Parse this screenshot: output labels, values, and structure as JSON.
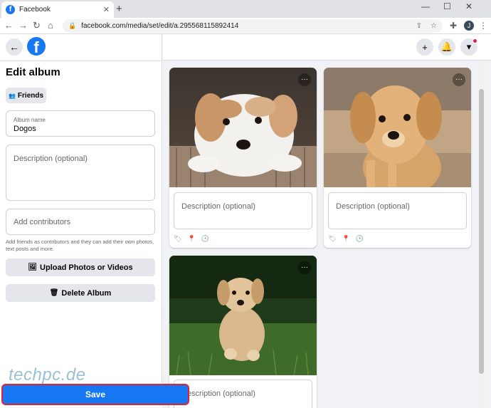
{
  "browser": {
    "tab_title": "Facebook",
    "url": "facebook.com/media/set/edit/a.295568115892414",
    "profile_initial": "J"
  },
  "left": {
    "page_title": "Edit album",
    "privacy_label": "Friends",
    "album_name_label": "Album name",
    "album_name_value": "Dogos",
    "description_placeholder": "Description (optional)",
    "contributors_placeholder": "Add contributors",
    "contributors_hint": "Add friends as contributors and they can add their own photos, text posts and more.",
    "upload_label": "Upload Photos or Videos",
    "delete_label": "Delete Album",
    "save_label": "Save"
  },
  "photos": [
    {
      "description_placeholder": "Description (optional)"
    },
    {
      "description_placeholder": "Description (optional)"
    },
    {
      "description_placeholder": "Description (optional)"
    }
  ],
  "watermark": "techpc.de",
  "colors": {
    "accent": "#1877f2",
    "highlight": "#e0242e"
  }
}
